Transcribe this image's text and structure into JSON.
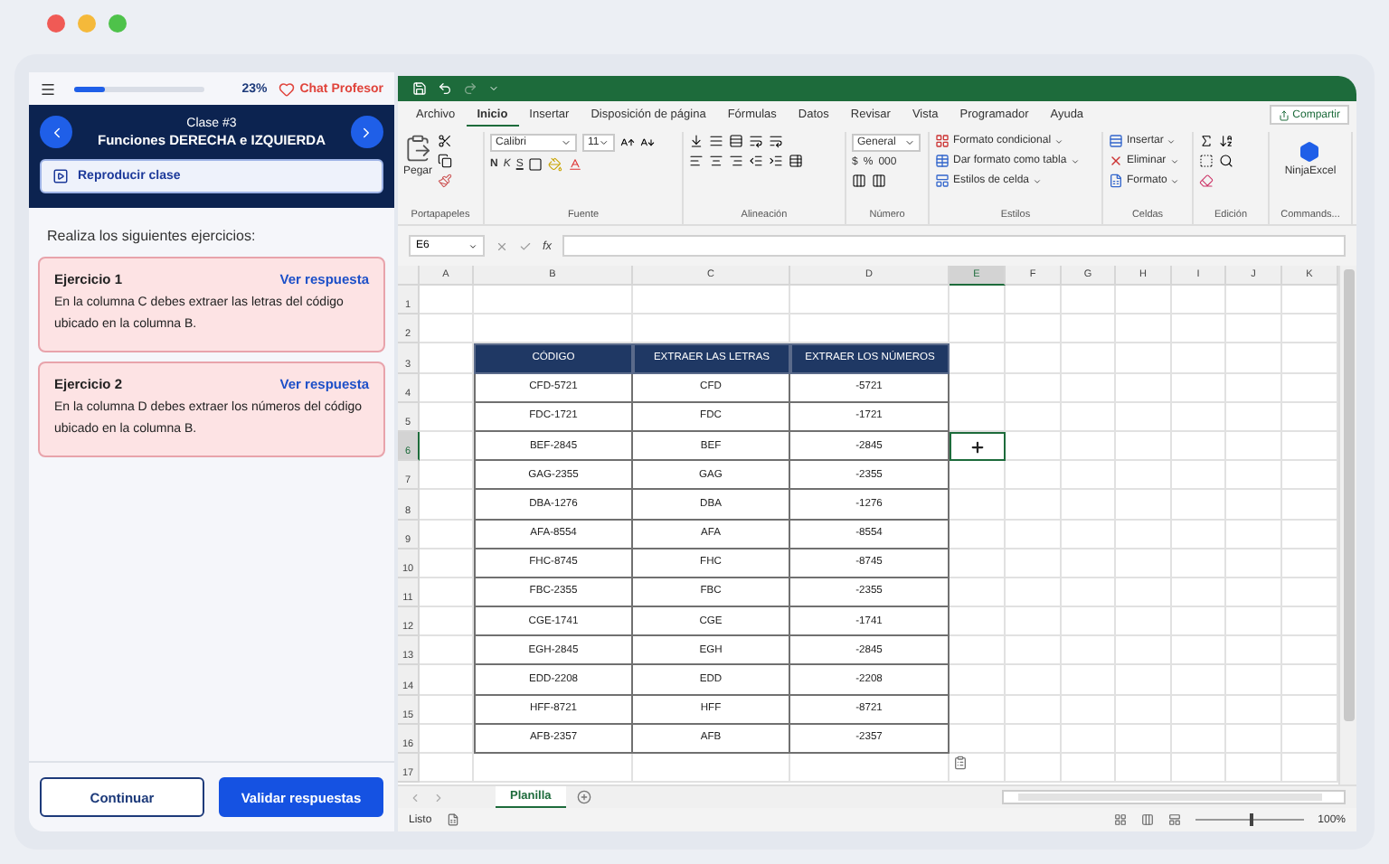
{
  "lesson": {
    "progress": {
      "level": 0.23
    },
    "progress_text": "23%",
    "chat_button": "Chat Profesor",
    "class_number": "Clase #3",
    "class_title": "Funciones DERECHA e IZQUIERDA",
    "play_button": "Reproducir clase",
    "instructions": "Realiza los siguientes ejercicios:",
    "exercises": [
      {
        "title": "Ejercicio 1",
        "link": "Ver respuesta",
        "text": "En la columna C debes extraer las letras del código ubicado en la columna B."
      },
      {
        "title": "Ejercicio 2",
        "link": "Ver respuesta",
        "text": "En la columna D debes extraer los números del código ubicado en la columna B."
      }
    ],
    "buttons": [
      {
        "label": "Continuar",
        "kind": "secondary"
      },
      {
        "label": "Validar respuestas",
        "kind": "primary"
      }
    ]
  },
  "excel": {
    "menu_tabs": [
      {
        "label": "Archivo",
        "selected": false
      },
      {
        "label": "Inicio",
        "selected": true
      },
      {
        "label": "Insertar",
        "selected": false
      },
      {
        "label": "Disposición de página",
        "selected": false
      },
      {
        "label": "Fórmulas",
        "selected": false
      },
      {
        "label": "Datos",
        "selected": false
      },
      {
        "label": "Revisar",
        "selected": false
      },
      {
        "label": "Vista",
        "selected": false
      },
      {
        "label": "Programador",
        "selected": false
      },
      {
        "label": "Ayuda",
        "selected": false
      }
    ],
    "share_button": "Compartir",
    "ribbon": [
      {
        "kind": "clipboard",
        "label": "Portapapeles",
        "paste": "Pegar"
      },
      {
        "kind": "font",
        "label": "Fuente",
        "font": "Calibri",
        "size": "11",
        "styles": [
          "N",
          "K",
          "S"
        ]
      },
      {
        "kind": "alignment",
        "label": "Alineación"
      },
      {
        "kind": "number",
        "label": "Número",
        "format": "General",
        "symbols": [
          "$",
          "%",
          "000"
        ]
      },
      {
        "kind": "styles",
        "label": "Estilos",
        "items": [
          "Formato condicional",
          "Dar formato como tabla",
          "Estilos de celda"
        ]
      },
      {
        "kind": "cells",
        "label": "Celdas",
        "items": [
          "Insertar",
          "Eliminar",
          "Formato"
        ]
      },
      {
        "kind": "editing",
        "label": "Edición"
      },
      {
        "kind": "addin",
        "label": "Commands...",
        "name": "NinjaExcel"
      }
    ],
    "name_box": "E6",
    "formula_symbol": "fx",
    "columns": [
      {
        "label": "A",
        "selected": false
      },
      {
        "label": "B",
        "selected": false
      },
      {
        "label": "C",
        "selected": false
      },
      {
        "label": "D",
        "selected": false
      },
      {
        "label": "E",
        "selected": true
      },
      {
        "label": "F",
        "selected": false
      },
      {
        "label": "G",
        "selected": false
      },
      {
        "label": "H",
        "selected": false
      },
      {
        "label": "I",
        "selected": false
      },
      {
        "label": "J",
        "selected": false
      },
      {
        "label": "K",
        "selected": false
      }
    ],
    "rows": [
      {
        "label": "1",
        "selected": false
      },
      {
        "label": "2",
        "selected": false
      },
      {
        "label": "3",
        "selected": false
      },
      {
        "label": "4",
        "selected": false
      },
      {
        "label": "5",
        "selected": false
      },
      {
        "label": "6",
        "selected": true
      },
      {
        "label": "7",
        "selected": false
      },
      {
        "label": "8",
        "selected": false
      },
      {
        "label": "9",
        "selected": false
      },
      {
        "label": "10",
        "selected": false
      },
      {
        "label": "11",
        "selected": false
      },
      {
        "label": "12",
        "selected": false
      },
      {
        "label": "13",
        "selected": false
      },
      {
        "label": "14",
        "selected": false
      },
      {
        "label": "15",
        "selected": false
      },
      {
        "label": "16",
        "selected": false
      },
      {
        "label": "17",
        "selected": false
      }
    ],
    "table": {
      "header": [
        "CÓDIGO",
        "EXTRAER LAS LETRAS",
        "EXTRAER LOS NÚMEROS"
      ],
      "rows": [
        [
          "CFD-5721",
          "CFD",
          "-5721"
        ],
        [
          "FDC-1721",
          "FDC",
          "-1721"
        ],
        [
          "BEF-2845",
          "BEF",
          "-2845"
        ],
        [
          "GAG-2355",
          "GAG",
          "-2355"
        ],
        [
          "DBA-1276",
          "DBA",
          "-1276"
        ],
        [
          "AFA-8554",
          "AFA",
          "-8554"
        ],
        [
          "FHC-8745",
          "FHC",
          "-8745"
        ],
        [
          "FBC-2355",
          "FBC",
          "-2355"
        ],
        [
          "CGE-1741",
          "CGE",
          "-1741"
        ],
        [
          "EGH-2845",
          "EGH",
          "-2845"
        ],
        [
          "EDD-2208",
          "EDD",
          "-2208"
        ],
        [
          "HFF-8721",
          "HFF",
          "-8721"
        ],
        [
          "AFB-2357",
          "AFB",
          "-2357"
        ]
      ]
    },
    "sheet_tabs": [
      {
        "label": "Planilla",
        "selected": true
      }
    ],
    "status": "Listo",
    "zoom": {
      "level": 0.5,
      "text": "100%"
    }
  }
}
